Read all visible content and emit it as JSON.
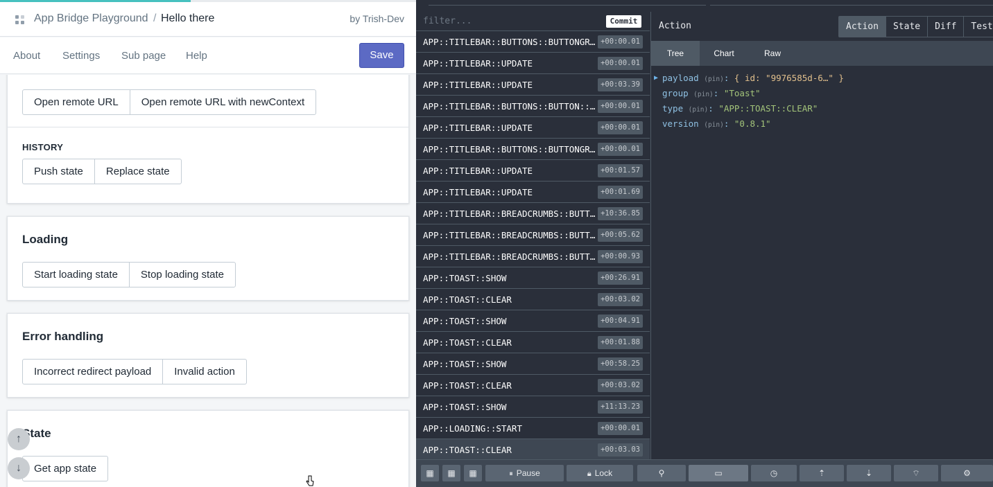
{
  "app": {
    "breadcrumb": "App Bridge Playground",
    "separator": "/",
    "page_title": "Hello there",
    "byline": "by Trish-Dev",
    "nav": [
      "About",
      "Settings",
      "Sub page",
      "Help"
    ],
    "save_label": "Save"
  },
  "sections": {
    "remote": {
      "buttons": [
        "Open remote URL",
        "Open remote URL with newContext"
      ]
    },
    "history": {
      "label": "HISTORY",
      "buttons": [
        "Push state",
        "Replace state"
      ]
    },
    "loading": {
      "title": "Loading",
      "buttons": [
        "Start loading state",
        "Stop loading state"
      ]
    },
    "errors": {
      "title": "Error handling",
      "buttons": [
        "Incorrect redirect payload",
        "Invalid action"
      ]
    },
    "state": {
      "title": "State",
      "buttons": [
        "Get app state"
      ]
    }
  },
  "scroll_buttons": {
    "up": "↑",
    "down": "↓"
  },
  "devtools": {
    "filter_placeholder": "filter...",
    "commit_label": "Commit",
    "actions": [
      {
        "type": "APP::TITLEBAR::BUTTONS::BUTTONGROUP::UPDATE",
        "time": "+00:00.01"
      },
      {
        "type": "APP::TITLEBAR::UPDATE",
        "time": "+00:00.01"
      },
      {
        "type": "APP::TITLEBAR::UPDATE",
        "time": "+00:03.39"
      },
      {
        "type": "APP::TITLEBAR::BUTTONS::BUTTON::UPDATE",
        "time": "+00:00.01"
      },
      {
        "type": "APP::TITLEBAR::UPDATE",
        "time": "+00:00.01"
      },
      {
        "type": "APP::TITLEBAR::BUTTONS::BUTTONGROUP::UPDATE",
        "time": "+00:00.01"
      },
      {
        "type": "APP::TITLEBAR::UPDATE",
        "time": "+00:01.57"
      },
      {
        "type": "APP::TITLEBAR::UPDATE",
        "time": "+00:01.69"
      },
      {
        "type": "APP::TITLEBAR::BREADCRUMBS::BUTTON::CLICK",
        "time": "+10:36.85"
      },
      {
        "type": "APP::TITLEBAR::BREADCRUMBS::BUTTON::UPDATE",
        "time": "+00:05.62"
      },
      {
        "type": "APP::TITLEBAR::BREADCRUMBS::BUTTON::UPDATE",
        "time": "+00:00.93"
      },
      {
        "type": "APP::TOAST::SHOW",
        "time": "+00:26.91"
      },
      {
        "type": "APP::TOAST::CLEAR",
        "time": "+00:03.02"
      },
      {
        "type": "APP::TOAST::SHOW",
        "time": "+00:04.91"
      },
      {
        "type": "APP::TOAST::CLEAR",
        "time": "+00:01.88"
      },
      {
        "type": "APP::TOAST::SHOW",
        "time": "+00:58.25"
      },
      {
        "type": "APP::TOAST::CLEAR",
        "time": "+00:03.02"
      },
      {
        "type": "APP::TOAST::SHOW",
        "time": "+11:13.23"
      },
      {
        "type": "APP::LOADING::START",
        "time": "+00:00.01"
      },
      {
        "type": "APP::TOAST::CLEAR",
        "time": "+00:03.03",
        "selected": true
      }
    ],
    "panel_title": "Action",
    "tabs": [
      "Action",
      "State",
      "Diff",
      "Test"
    ],
    "active_tab": "Action",
    "subtabs": [
      "Tree",
      "Chart",
      "Raw"
    ],
    "active_subtab": "Tree",
    "tree": {
      "pin": "(pin)",
      "payload_key": "payload",
      "payload_value": "{ id: \"9976585d-6…\" }",
      "group_key": "group",
      "group_value": "\"Toast\"",
      "type_key": "type",
      "type_value": "\"APP::TOAST::CLEAR\"",
      "version_key": "version",
      "version_value": "\"0.8.1\""
    },
    "bottom": {
      "pause_label": "Pause",
      "lock_label": "Lock"
    }
  },
  "colors": {
    "save_button": "#5c6ac4",
    "devtools_bg": "#2a2f3a",
    "key_blue": "#8fc1e3",
    "string_value": "#e2c08d",
    "progress": "#47c1bf"
  }
}
